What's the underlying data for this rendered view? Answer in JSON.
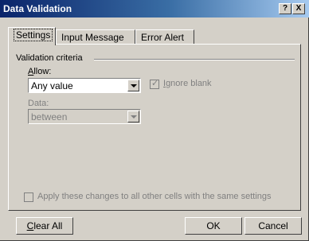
{
  "window": {
    "title": "Data Validation"
  },
  "title_buttons": {
    "help": "?",
    "close": "X"
  },
  "tabs": [
    {
      "label": "Settings",
      "active": true
    },
    {
      "label": "Input Message",
      "active": false
    },
    {
      "label": "Error Alert",
      "active": false
    }
  ],
  "settings": {
    "group_label": "Validation criteria",
    "allow": {
      "label": "Allow:",
      "value": "Any value"
    },
    "ignore_blank": {
      "label": "Ignore blank",
      "checked": true,
      "enabled": false
    },
    "data": {
      "label": "Data:",
      "value": "between",
      "enabled": false
    },
    "apply_all": {
      "label": "Apply these changes to all other cells with the same settings",
      "checked": false,
      "enabled": false
    }
  },
  "buttons": {
    "clear_all": "Clear All",
    "ok": "OK",
    "cancel": "Cancel"
  }
}
